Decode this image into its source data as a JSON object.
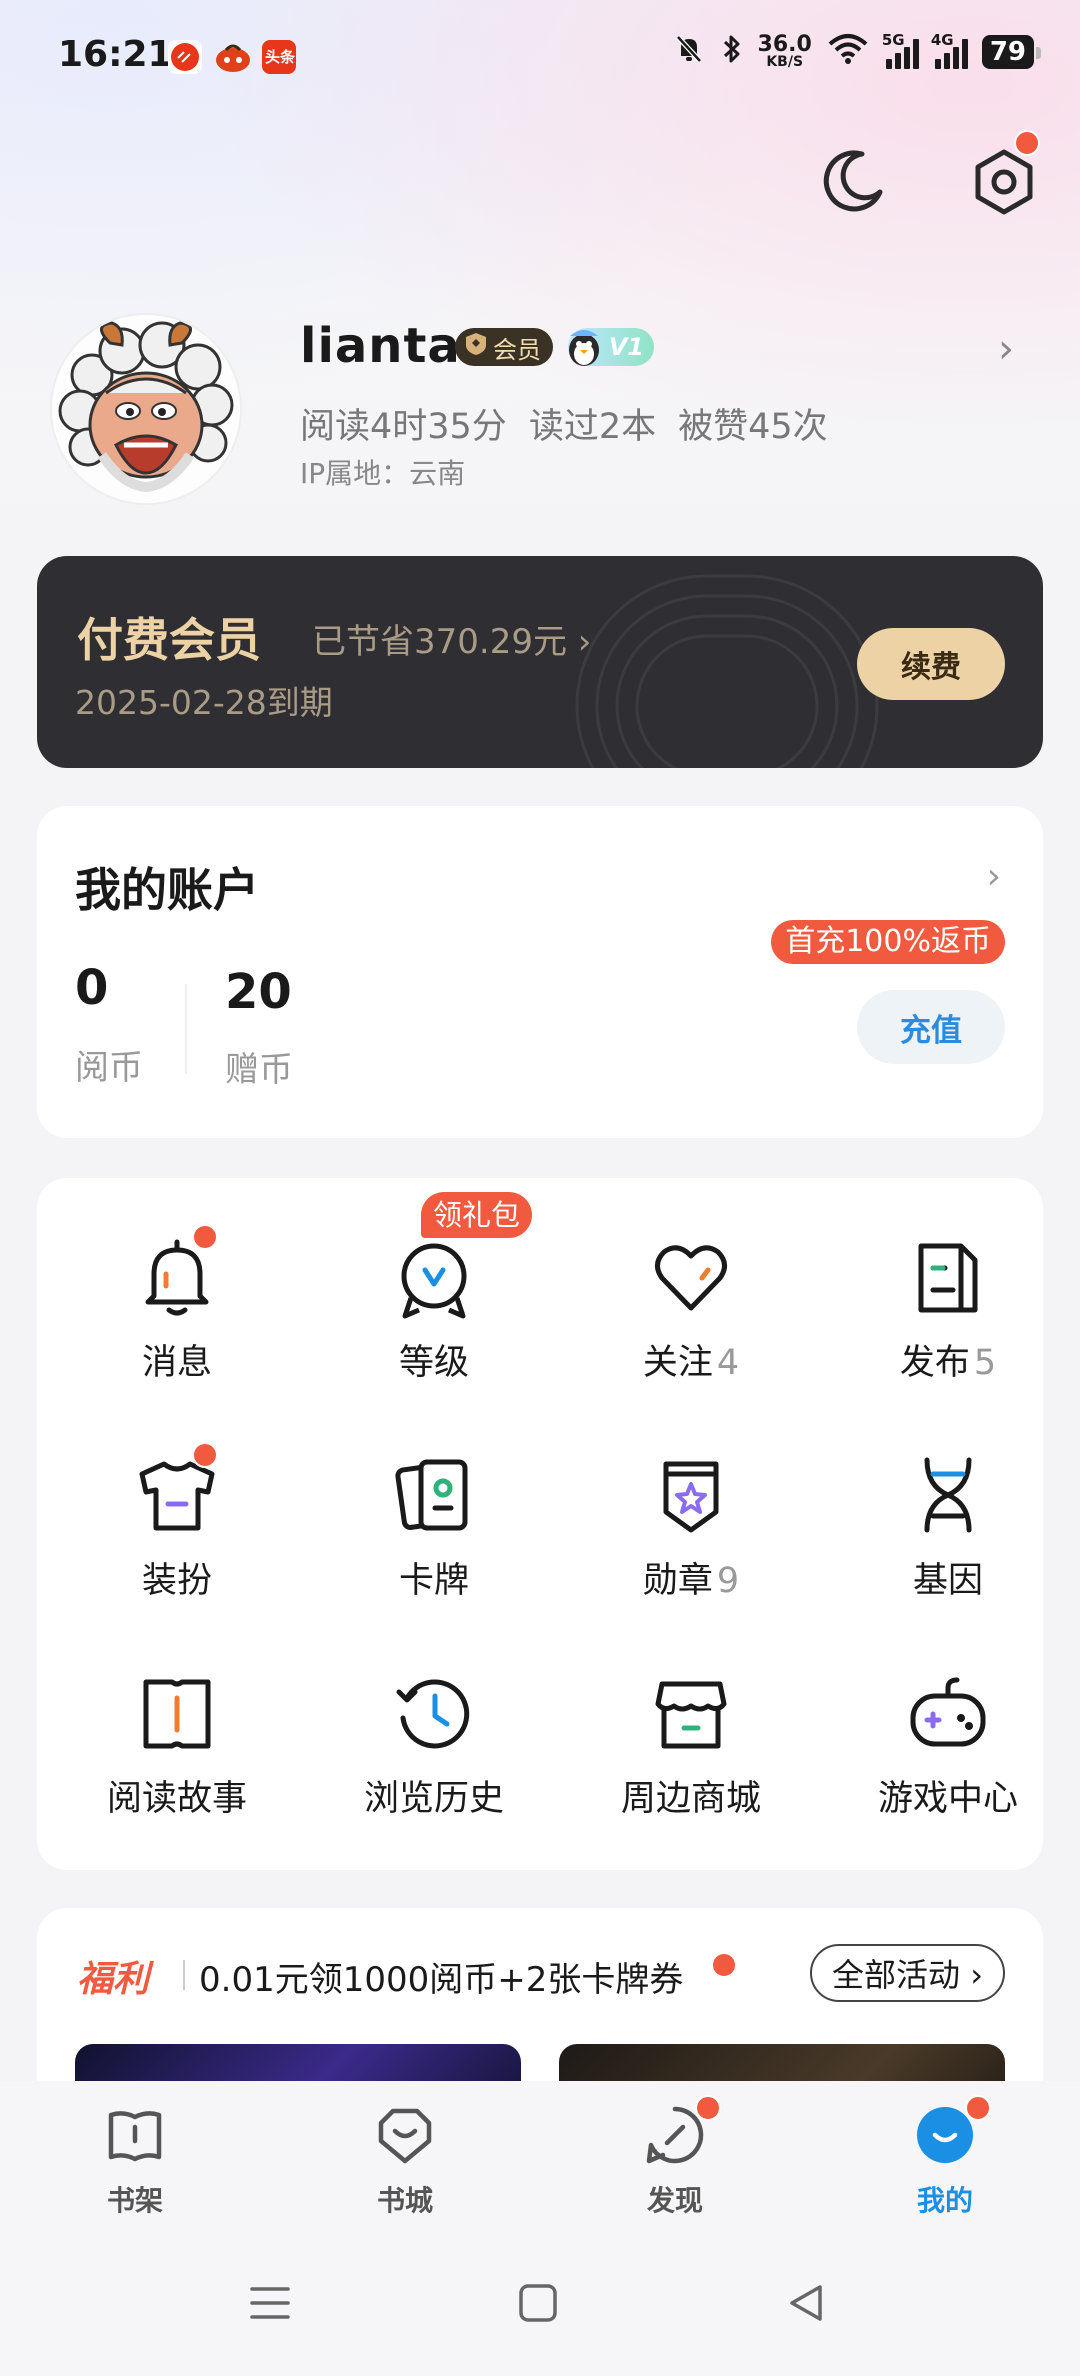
{
  "status_bar": {
    "time": "16:21",
    "net_speed": "36.0",
    "net_unit": "KB/S",
    "signal1": "5G",
    "signal2": "4G",
    "battery": "79"
  },
  "profile": {
    "username": "lianta",
    "vip_label": "会员",
    "level_label": "V1",
    "stats": [
      "阅读4时35分",
      "读过2本",
      "被赞45次"
    ],
    "ip": "IP属地：云南"
  },
  "membership": {
    "title": "付费会员",
    "saved": "已节省370.29元 ›",
    "expiry": "2025-02-28到期",
    "renew": "续费",
    "accent": "#ECD2A4"
  },
  "account": {
    "title": "我的账户",
    "coins": "0",
    "coins_label": "阅币",
    "gift_coins": "20",
    "gift_coins_label": "赠币",
    "promo": "首充100%返币",
    "recharge": "充值"
  },
  "grid": {
    "gift_badge": "领礼包",
    "items": [
      {
        "label": "消息",
        "count": ""
      },
      {
        "label": "等级",
        "count": ""
      },
      {
        "label": "关注",
        "count": "4"
      },
      {
        "label": "发布",
        "count": "5"
      },
      {
        "label": "装扮",
        "count": ""
      },
      {
        "label": "卡牌",
        "count": ""
      },
      {
        "label": "勋章",
        "count": "9"
      },
      {
        "label": "基因",
        "count": ""
      },
      {
        "label": "阅读故事",
        "count": ""
      },
      {
        "label": "浏览历史",
        "count": ""
      },
      {
        "label": "周边商城",
        "count": ""
      },
      {
        "label": "游戏中心",
        "count": ""
      }
    ]
  },
  "welfare": {
    "tag": "福利",
    "text": "0.01元领1000阅币+2张卡牌券",
    "all_button": "全部活动 ›"
  },
  "bottom_nav": {
    "tabs": [
      "书架",
      "书城",
      "发现",
      "我的"
    ],
    "active_color": "#1A8FE3"
  }
}
